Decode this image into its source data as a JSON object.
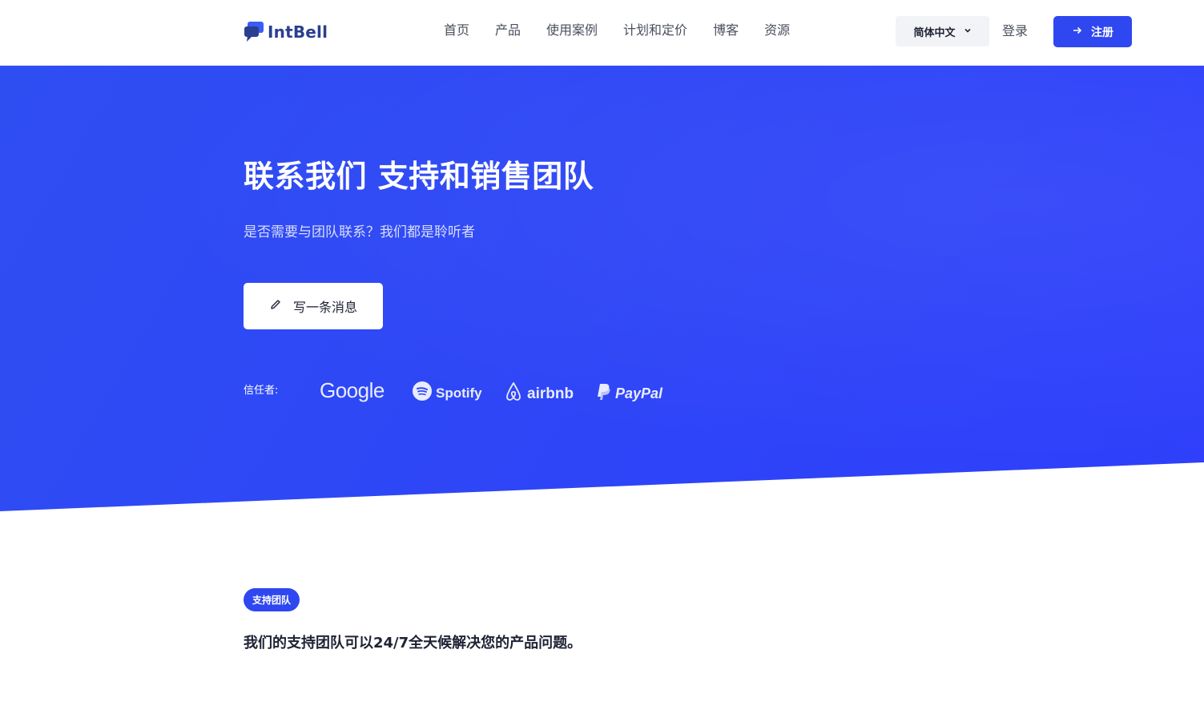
{
  "brand": {
    "name": "IntBell",
    "color": "#2a3f8f",
    "icon": "chat-bubble-icon"
  },
  "nav": {
    "items": [
      "首页",
      "产品",
      "使用案例",
      "计划和定价",
      "博客",
      "资源"
    ]
  },
  "header": {
    "language": "简体中文",
    "login": "登录",
    "signup": "注册"
  },
  "hero": {
    "title": "联系我们 支持和销售团队",
    "subtitle": "是否需要与团队联系？我们都是聆听者",
    "message_button": "写一条消息",
    "trusted_label": "信任者:",
    "logos": [
      "Google",
      "Spotify",
      "airbnb",
      "PayPal"
    ],
    "bg_color": "#2e45f7"
  },
  "support": {
    "tag": "支持团队",
    "text": "我们的支持团队可以24/7全天候解决您的产品问题。"
  },
  "colors": {
    "accent": "#2f47f0"
  }
}
